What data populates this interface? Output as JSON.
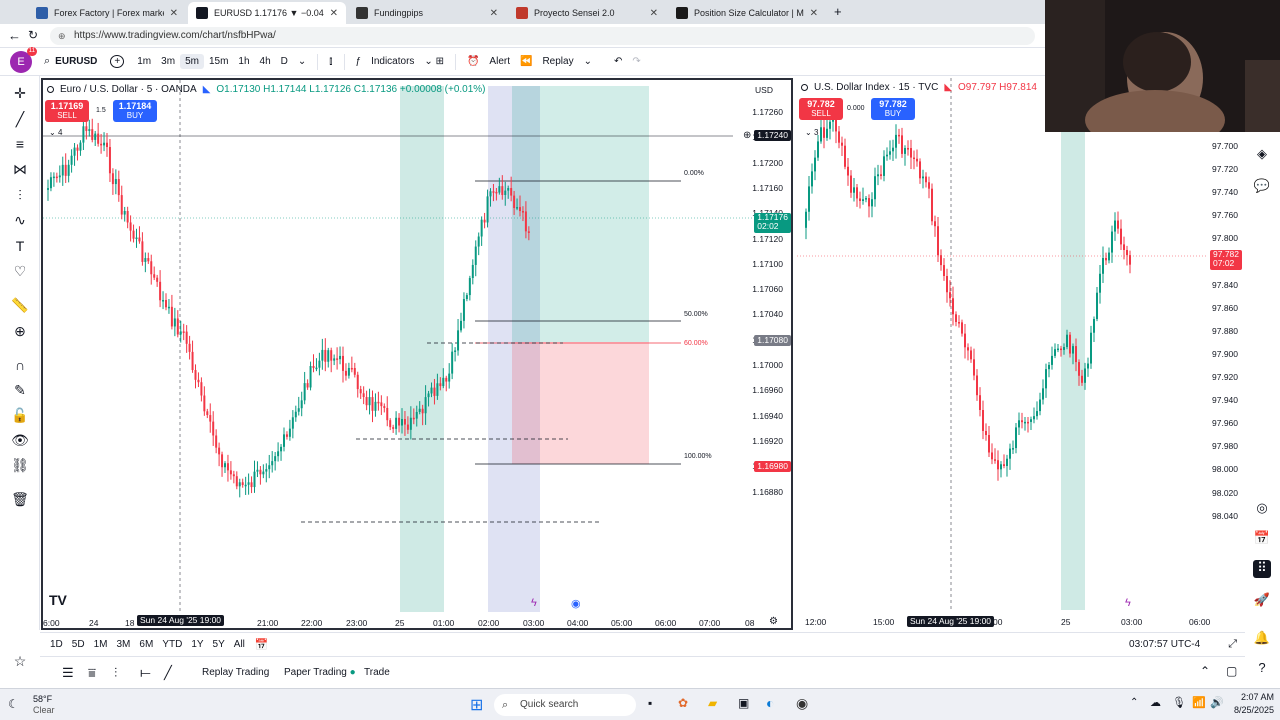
{
  "browser": {
    "tabs": [
      {
        "title": "Forex Factory | Forex markets for",
        "color": "#2e5ea8",
        "active": false
      },
      {
        "title": "EURUSD 1.17176 ▼ −0.04% se",
        "color": "#131722",
        "active": true
      },
      {
        "title": "Fundingpips",
        "color": "#333333",
        "active": false
      },
      {
        "title": "Proyecto Sensei 2.0",
        "color": "#c0392b",
        "active": false
      },
      {
        "title": "Position Size Calculator | Myfxboo",
        "color": "#1a1a1a",
        "active": false
      }
    ],
    "url": "https://www.tradingview.com/chart/nsfbHPwa/"
  },
  "toolbar": {
    "avatar": "E",
    "avatar_badge": "11",
    "symbol": "EURUSD",
    "intervals": [
      "1m",
      "3m",
      "5m",
      "15m",
      "1h",
      "4h",
      "D"
    ],
    "selected_interval": "5m",
    "indicators": "Indicators",
    "alert": "Alert",
    "replay": "Replay"
  },
  "chart1": {
    "title": "Euro / U.S. Dollar · 5 · OANDA",
    "ohlc": "O1.17130 H1.17144 L1.17126 C1.17136 +0.00008 (+0.01%)",
    "sell_price": "1.17169",
    "sell_label": "SELL",
    "spread": "1.5",
    "buy_price": "1.17184",
    "buy_label": "BUY",
    "indicator_count": "4",
    "currency": "USD",
    "price_ticks": [
      "1.17260",
      "1.17220",
      "1.17200",
      "1.17160",
      "1.17140",
      "1.17120",
      "1.17100",
      "1.17060",
      "1.17040",
      "1.17020",
      "1.17000",
      "1.16960",
      "1.16940",
      "1.16920",
      "1.16900",
      "1.16880"
    ],
    "crosshair_price": "1.17240",
    "last_price": "1.17176",
    "countdown": "02:02",
    "level_price": "1.17080",
    "stop_price": "1.16980",
    "fib": [
      "0.00%",
      "50.00%",
      "60.00%",
      "100.00%"
    ],
    "time_ticks": [
      "6:00",
      "24",
      "18",
      "21:00",
      "22:00",
      "23:00",
      "25",
      "01:00",
      "02:00",
      "03:00",
      "04:00",
      "05:00",
      "06:00",
      "07:00",
      "08"
    ],
    "crosshair_time": "Sun 24 Aug '25   19:00"
  },
  "chart2": {
    "title": "U.S. Dollar Index · 15 · TVC",
    "ohlc": "O97.797 H97.814",
    "sell_price": "97.782",
    "sell_label": "SELL",
    "spread": "0.000",
    "buy_price": "97.782",
    "buy_label": "BUY",
    "indicator_count": "3",
    "price_ticks": [
      "97.700",
      "97.720",
      "97.740",
      "97.760",
      "97.800",
      "97.820",
      "97.840",
      "97.860",
      "97.880",
      "97.900",
      "97.920",
      "97.940",
      "97.960",
      "97.980",
      "98.000",
      "98.020",
      "98.040"
    ],
    "last_price": "97.782",
    "countdown": "07:02",
    "time_ticks": [
      "12:00",
      "15:00",
      "00",
      "25",
      "03:00",
      "06:00"
    ],
    "crosshair_time": "Sun 24 Aug '25   19:00"
  },
  "ranges": [
    "1D",
    "5D",
    "1M",
    "3M",
    "6M",
    "YTD",
    "1Y",
    "5Y",
    "All"
  ],
  "clock": "03:07:57 UTC-4",
  "bottom_tabs": [
    "Replay Trading",
    "Paper Trading",
    "Trade"
  ],
  "taskbar": {
    "temp": "58°F",
    "weather": "Clear",
    "search": "Quick search",
    "time": "2:07 AM",
    "date": "8/25/2025"
  },
  "colors": {
    "up": "#089981",
    "down": "#f23645",
    "session": "#a8d9cf",
    "blue": "#2962ff"
  }
}
